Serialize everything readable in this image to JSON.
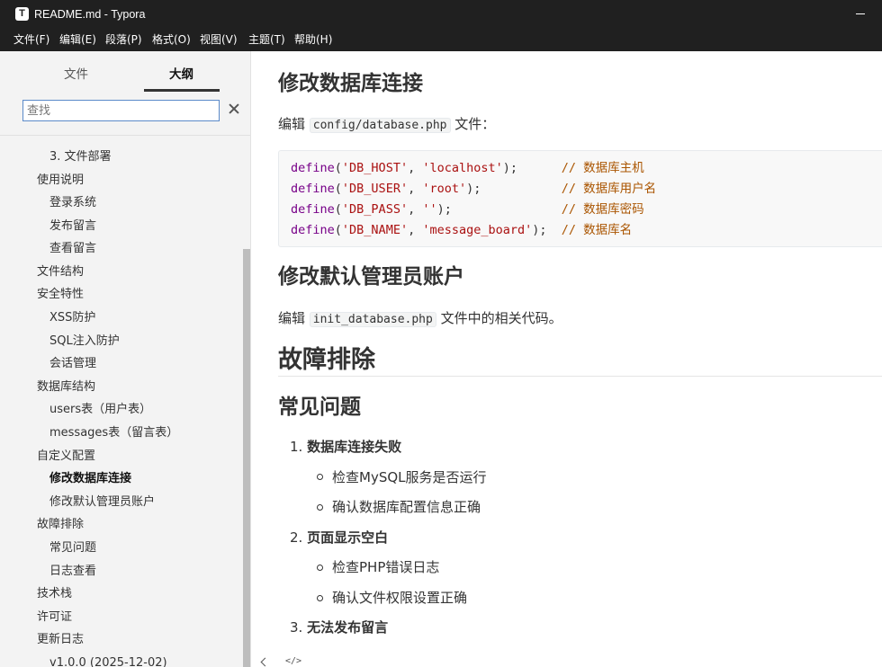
{
  "window": {
    "app_icon_letter": "T",
    "title": "README.md - Typora"
  },
  "menubar": [
    "文件(F)",
    "编辑(E)",
    "段落(P)",
    "格式(O)",
    "视图(V)",
    "主题(T)",
    "帮助(H)"
  ],
  "sidebar": {
    "tabs": [
      "文件",
      "大纲"
    ],
    "active_tab": "大纲",
    "search_placeholder": "查找",
    "outline": [
      {
        "label": "3. 文件部署",
        "level": 2,
        "active": false
      },
      {
        "label": "使用说明",
        "level": 1,
        "active": false
      },
      {
        "label": "登录系统",
        "level": 2,
        "active": false
      },
      {
        "label": "发布留言",
        "level": 2,
        "active": false
      },
      {
        "label": "查看留言",
        "level": 2,
        "active": false
      },
      {
        "label": "文件结构",
        "level": 1,
        "active": false
      },
      {
        "label": "安全特性",
        "level": 1,
        "active": false
      },
      {
        "label": "XSS防护",
        "level": 2,
        "active": false
      },
      {
        "label": "SQL注入防护",
        "level": 2,
        "active": false
      },
      {
        "label": "会话管理",
        "level": 2,
        "active": false
      },
      {
        "label": "数据库结构",
        "level": 1,
        "active": false
      },
      {
        "label": "users表（用户表）",
        "level": 2,
        "active": false
      },
      {
        "label": "messages表（留言表）",
        "level": 2,
        "active": false
      },
      {
        "label": "自定义配置",
        "level": 1,
        "active": false
      },
      {
        "label": "修改数据库连接",
        "level": 2,
        "active": true
      },
      {
        "label": "修改默认管理员账户",
        "level": 2,
        "active": false
      },
      {
        "label": "故障排除",
        "level": 1,
        "active": false
      },
      {
        "label": "常见问题",
        "level": 2,
        "active": false
      },
      {
        "label": "日志查看",
        "level": 2,
        "active": false
      },
      {
        "label": "技术栈",
        "level": 1,
        "active": false
      },
      {
        "label": "许可证",
        "level": 1,
        "active": false
      },
      {
        "label": "更新日志",
        "level": 1,
        "active": false
      },
      {
        "label": "v1.0.0 (2025-12-02)",
        "level": 2,
        "active": false
      }
    ]
  },
  "content": {
    "h_db": "修改数据库连接",
    "p_db": {
      "pre": "编辑 ",
      "code": "config/database.php",
      "post": " 文件："
    },
    "code_lines": [
      {
        "fn": "define",
        "arg1": "'DB_HOST'",
        "arg2": "'localhost'",
        "end": ");",
        "comment": "// 数据库主机"
      },
      {
        "fn": "define",
        "arg1": "'DB_USER'",
        "arg2": "'root'",
        "end": ");",
        "comment": "// 数据库用户名"
      },
      {
        "fn": "define",
        "arg1": "'DB_PASS'",
        "arg2": "''",
        "end": ");",
        "comment": "// 数据库密码"
      },
      {
        "fn": "define",
        "arg1": "'DB_NAME'",
        "arg2": "'message_board'",
        "end": ");",
        "comment": "// 数据库名"
      }
    ],
    "h_admin": "修改默认管理员账户",
    "p_admin": {
      "pre": "编辑 ",
      "code": "init_database.php",
      "post": " 文件中的相关代码。"
    },
    "h_trouble": "故障排除",
    "h_faq": "常见问题",
    "faq": [
      {
        "num": "1.",
        "title": "数据库连接失败",
        "items": [
          "检查MySQL服务是否运行",
          "确认数据库配置信息正确"
        ]
      },
      {
        "num": "2.",
        "title": "页面显示空白",
        "items": [
          "检查PHP错误日志",
          "确认文件权限设置正确"
        ]
      },
      {
        "num": "3.",
        "title": "无法发布留言",
        "items": []
      }
    ]
  },
  "statusbar": {
    "source_toggle": "</>"
  }
}
